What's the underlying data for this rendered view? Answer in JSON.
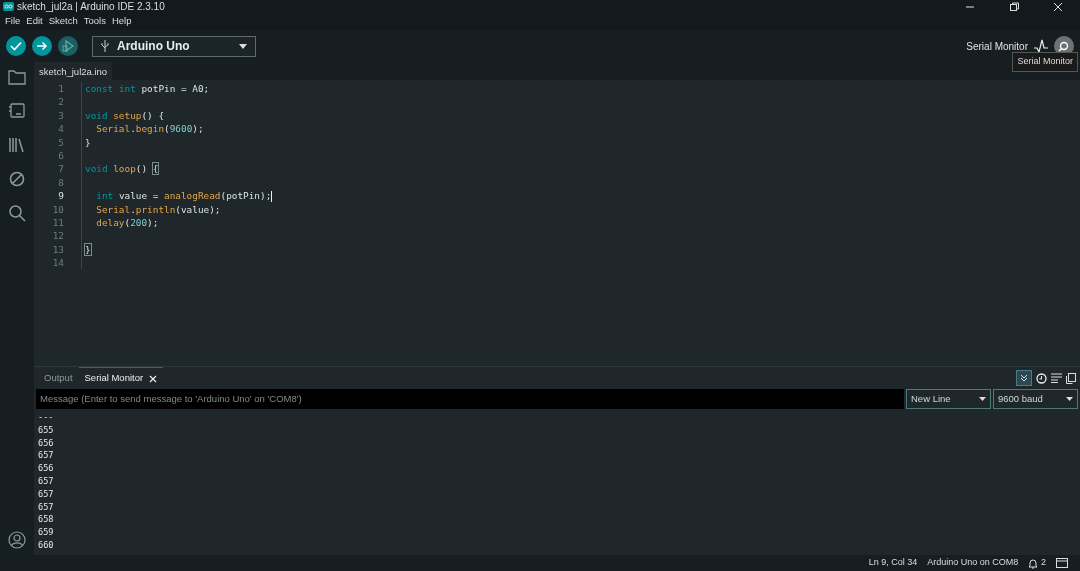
{
  "window": {
    "title": "sketch_jul2a | Arduino IDE 2.3.10"
  },
  "menu": [
    "File",
    "Edit",
    "Sketch",
    "Tools",
    "Help"
  ],
  "toolbar": {
    "board": "Arduino Uno",
    "serial_monitor_label": "Serial Monitor",
    "tooltip": "Serial Monitor"
  },
  "editor": {
    "tab": "sketch_jul2a.ino",
    "lines": [
      {
        "number": "1",
        "current": false,
        "tokens": [
          {
            "kind": "keyword",
            "text": "const"
          },
          {
            "kind": "keyword",
            "text": " int"
          },
          {
            "kind": "plain",
            "text": " potPin = A0;"
          }
        ]
      },
      {
        "number": "2",
        "current": false
      },
      {
        "number": "3",
        "current": false,
        "tokens": [
          {
            "kind": "keyword",
            "text": "void"
          },
          {
            "kind": "function",
            "text": " setup"
          },
          {
            "kind": "plain",
            "text": "() {"
          }
        ]
      },
      {
        "number": "4",
        "current": false,
        "tokens": [
          {
            "kind": "function",
            "text": "  Serial"
          },
          {
            "kind": "plain",
            "text": "."
          },
          {
            "kind": "function",
            "text": "begin"
          },
          {
            "kind": "plain",
            "text": "("
          },
          {
            "kind": "number",
            "text": "9600"
          },
          {
            "kind": "plain",
            "text": ");"
          }
        ]
      },
      {
        "number": "5",
        "current": false,
        "tokens": [
          {
            "kind": "plain",
            "text": "}"
          }
        ]
      },
      {
        "number": "6",
        "current": false
      },
      {
        "number": "7",
        "current": false,
        "tokens": [
          {
            "kind": "keyword",
            "text": "void"
          },
          {
            "kind": "function",
            "text": " loop"
          },
          {
            "kind": "plain",
            "text": "() "
          },
          {
            "kind": "bracket",
            "text": "{"
          }
        ]
      },
      {
        "number": "8",
        "current": false
      },
      {
        "number": "9",
        "current": true,
        "tokens": [
          {
            "kind": "keyword",
            "text": "  int"
          },
          {
            "kind": "plain",
            "text": " value = "
          },
          {
            "kind": "function",
            "text": "analogRead"
          },
          {
            "kind": "plain",
            "text": "(potPin);"
          }
        ]
      },
      {
        "number": "10",
        "current": false,
        "tokens": [
          {
            "kind": "function",
            "text": "  Serial"
          },
          {
            "kind": "plain",
            "text": "."
          },
          {
            "kind": "function",
            "text": "println"
          },
          {
            "kind": "plain",
            "text": "(value);"
          }
        ]
      },
      {
        "number": "11",
        "current": false,
        "tokens": [
          {
            "kind": "function",
            "text": "  delay"
          },
          {
            "kind": "plain",
            "text": "("
          },
          {
            "kind": "number",
            "text": "200"
          },
          {
            "kind": "plain",
            "text": ");"
          }
        ]
      },
      {
        "number": "12",
        "current": false
      },
      {
        "number": "13",
        "current": false,
        "tokens": [
          {
            "kind": "bracket",
            "text": "}"
          }
        ]
      },
      {
        "number": "14",
        "current": false
      }
    ]
  },
  "panel": {
    "tabs": [
      {
        "label": "Output",
        "selected": false
      },
      {
        "label": "Serial Monitor",
        "selected": true
      }
    ],
    "message": {
      "placeholder": "Message (Enter to send message to 'Arduino Uno' on 'COM8')"
    },
    "line_ending": "New Line",
    "baud": "9600 baud",
    "autoscroll": true,
    "output": [
      "---",
      "655",
      "656",
      "657",
      "656",
      "657",
      "657",
      "657",
      "658",
      "659",
      "660"
    ]
  },
  "status_bar": {
    "position": "Ln 9, Col 34",
    "board": "Arduino Uno on COM8",
    "notifications": "2"
  }
}
